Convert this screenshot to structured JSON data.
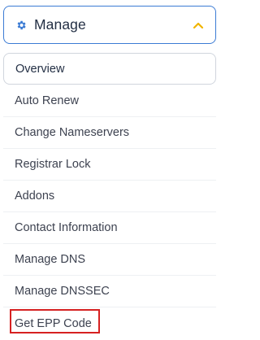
{
  "manage": {
    "title": "Manage",
    "icon": "gear-icon",
    "toggle_icon": "chevron-up-icon",
    "accent_color": "#3b7bd4",
    "chevron_color": "#f0b400"
  },
  "menu": {
    "items": [
      {
        "label": "Overview"
      },
      {
        "label": "Auto Renew"
      },
      {
        "label": "Change Nameservers"
      },
      {
        "label": "Registrar Lock"
      },
      {
        "label": "Addons"
      },
      {
        "label": "Contact Information"
      },
      {
        "label": "Manage DNS"
      },
      {
        "label": "Manage DNSSEC"
      },
      {
        "label": "Get EPP Code"
      }
    ],
    "active_index": 0,
    "highlight_color": "#d62121"
  }
}
